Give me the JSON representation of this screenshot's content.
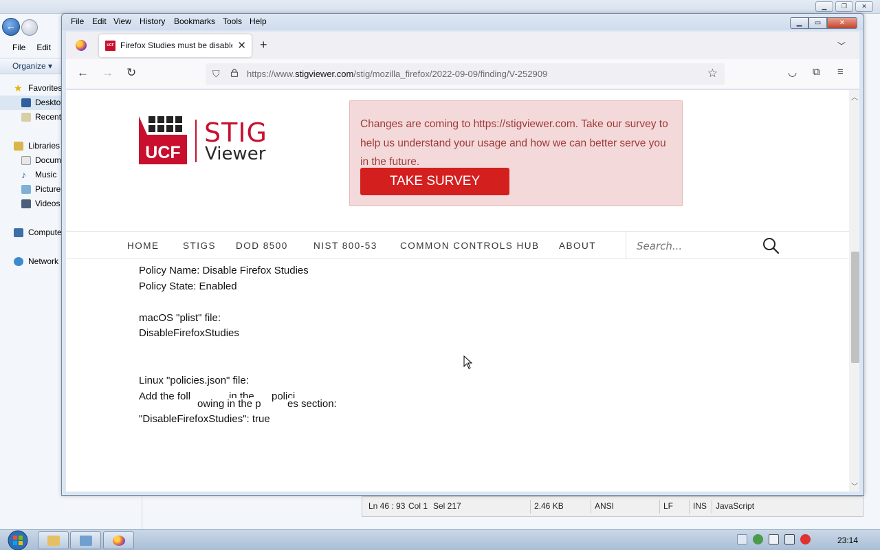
{
  "explorer": {
    "menu": [
      "File",
      "Edit"
    ],
    "organize": "Organize ▾",
    "nav_items": [
      "Favorites",
      "Desktop",
      "Recent",
      "Libraries",
      "Docum",
      "Music",
      "Picture",
      "Videos",
      "Compute",
      "Network"
    ]
  },
  "editor_status": {
    "ln": "Ln 46 : 93",
    "col": "Col 1",
    "sel": "Sel 217",
    "size": "2.46 KB",
    "encoding": "ANSI",
    "eol": "LF",
    "mode": "INS",
    "language": "JavaScript"
  },
  "firefox": {
    "menu": [
      "File",
      "Edit",
      "View",
      "History",
      "Bookmarks",
      "Tools",
      "Help"
    ],
    "tab_title": "Firefox Studies must be disabled",
    "url_prefix": "https://www.",
    "url_domain": "stigviewer.com",
    "url_path": "/stig/mozilla_firefox/2022-09-09/finding/V-252909"
  },
  "page": {
    "logo_mark": "UCF",
    "logo_stig": "STIG",
    "logo_viewer": "Viewer",
    "notice": "Changes are coming to https://stigviewer.com. Take our survey to help us understand your usage and how we can better serve you in the future.",
    "survey_button": "TAKE SURVEY",
    "nav": [
      "HOME",
      "STIGS",
      "DOD 8500",
      "NIST 800-53",
      "COMMON CONTROLS HUB",
      "ABOUT"
    ],
    "search_placeholder": "Search...",
    "lines": {
      "policy_name": "Policy Name: Disable Firefox Studies",
      "policy_state": "Policy State: Enabled",
      "macos_label": "macOS \"plist\" file:",
      "macos_value": "DisableFirefoxStudies",
      "linux_label": "Linux \"policies.json\" file:",
      "linux_add_a": "Add the foll",
      "linux_add_b": "in the",
      "linux_add_c": "polici",
      "linux_add_overlay": "owing in the p",
      "linux_add_tail": "es section:",
      "json_line": "\"DisableFirefoxStudies\": true"
    }
  },
  "taskbar": {
    "clock": "23:14"
  }
}
